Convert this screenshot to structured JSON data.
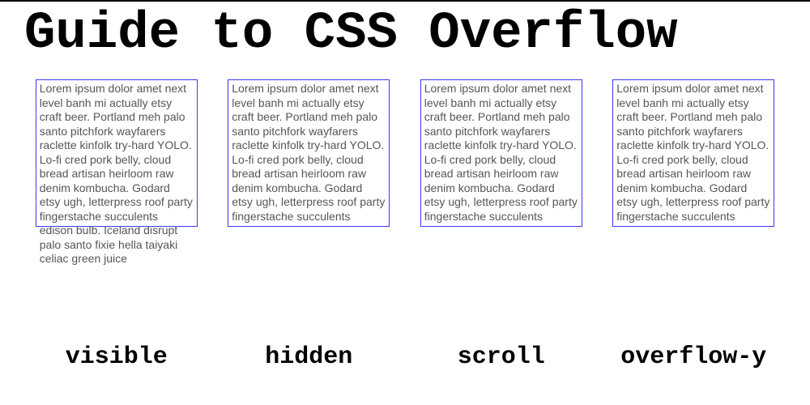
{
  "title": "Guide to CSS Overflow",
  "lorem": "Lorem ipsum dolor amet next level banh mi actually etsy craft beer. Portland meh palo santo pitchfork wayfarers raclette kinfolk try-hard YOLO. Lo-fi cred pork belly, cloud bread artisan heirloom raw denim kombucha. Godard etsy ugh, letterpress roof party fingerstache succulents edison bulb. Iceland disrupt palo santo fixie hella taiyaki celiac green juice",
  "examples": [
    {
      "label": "visible",
      "css": "visible"
    },
    {
      "label": "hidden",
      "css": "hidden"
    },
    {
      "label": "scroll",
      "css": "scroll"
    },
    {
      "label": "overflow-y",
      "css": "overflow-y"
    }
  ]
}
